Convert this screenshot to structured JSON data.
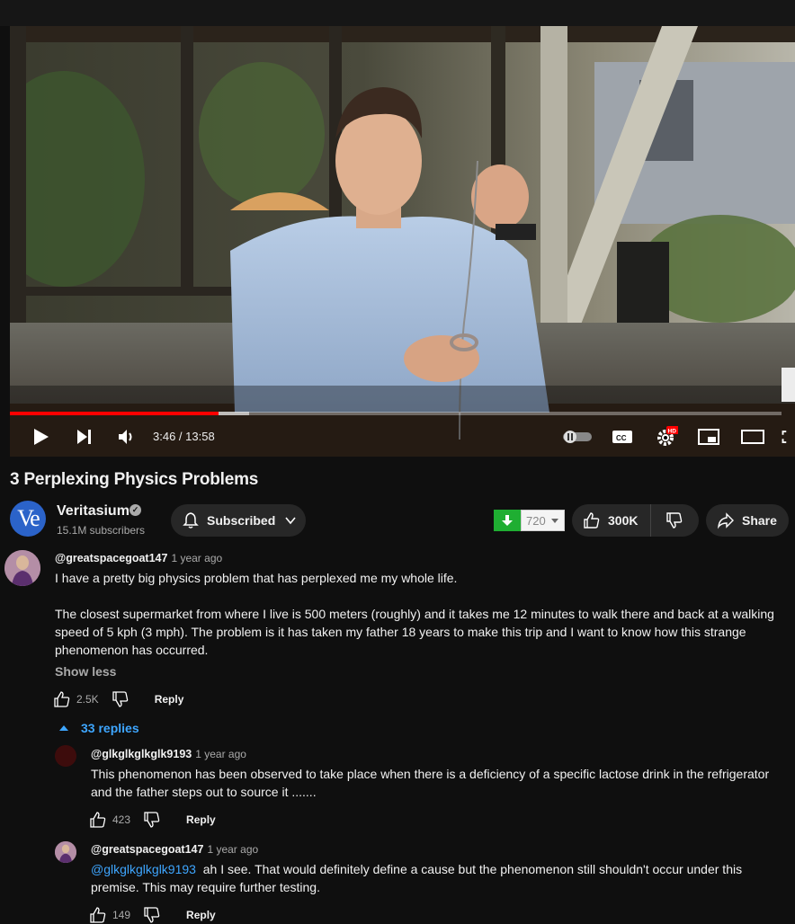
{
  "player": {
    "time_display": "3:46 / 13:58",
    "progress_fraction": 0.27,
    "buffer_fraction": 0.31,
    "hd_badge": "HD"
  },
  "video": {
    "title": "3 Perplexing Physics Problems"
  },
  "channel": {
    "avatar_text": "Ve",
    "name": "Veritasium",
    "subscribers": "15.1M subscribers",
    "subscribe_label": "Subscribed"
  },
  "actions": {
    "download_count": "720",
    "like_count": "300K",
    "share_label": "Share"
  },
  "comments": [
    {
      "author": "@greatspacegoat147",
      "time": "1 year ago",
      "paragraphs": [
        "I have a pretty big physics problem that has perplexed me my whole life.",
        "The closest supermarket from where I live is 500 meters (roughly) and it takes me 12 minutes to walk there and back at a walking speed of 5 kph (3 mph). The problem is it has taken my father 18 years to make this trip and I want to know how this strange phenomenon has occurred."
      ],
      "show_less": "Show less",
      "likes": "2.5K",
      "reply_label": "Reply",
      "replies_toggle": "33 replies"
    }
  ],
  "replies": [
    {
      "author": "@glkglkglkglk9193",
      "time": "1 year ago",
      "text": "This phenomenon has been observed to take place  when there is a deficiency of a specific  lactose drink in the refrigerator and the father steps out to source it .......",
      "likes": "423",
      "reply_label": "Reply"
    },
    {
      "author": "@greatspacegoat147",
      "time": "1 year ago",
      "mention": "@glkglkglkglk9193",
      "text": "  ah I see. That would definitely define a cause but the phenomenon still shouldn't occur under this premise. This may require further testing.",
      "likes": "149",
      "reply_label": "Reply"
    }
  ],
  "colors": {
    "progress": "#ff0000",
    "link": "#3ea6ff",
    "background": "#0f0f0f",
    "pill": "#272727",
    "download_green": "#1fae32"
  },
  "icons": [
    "play-icon",
    "next-icon",
    "volume-icon",
    "autoplay-toggle-icon",
    "captions-icon",
    "settings-icon",
    "miniplayer-icon",
    "theater-icon",
    "fullscreen-icon",
    "bell-icon",
    "chevron-down-icon",
    "download-icon",
    "like-icon",
    "dislike-icon",
    "share-icon"
  ]
}
